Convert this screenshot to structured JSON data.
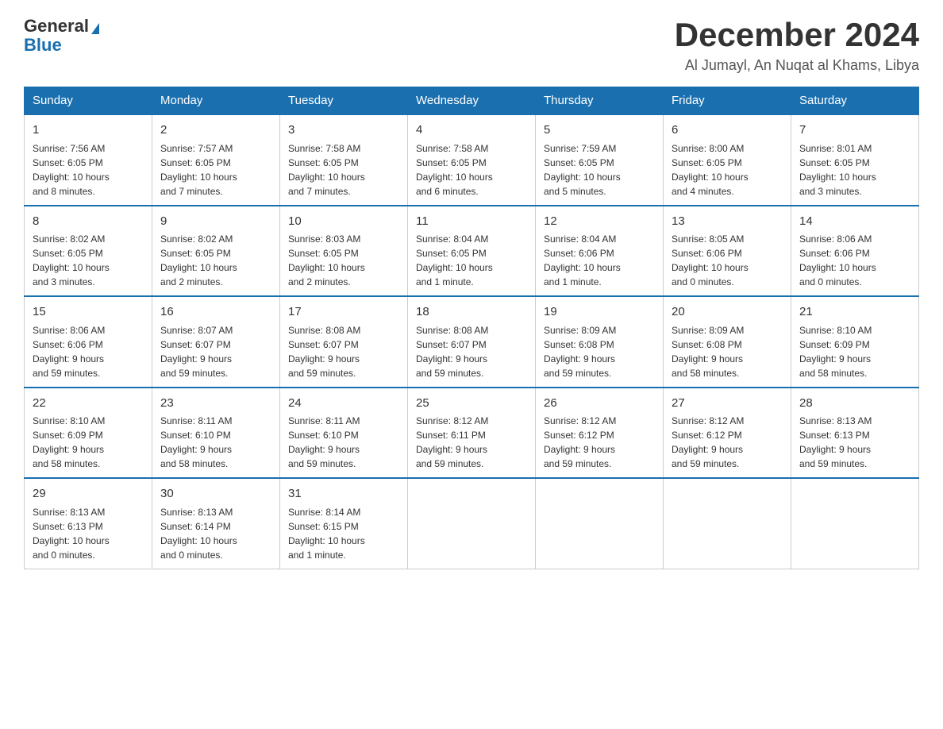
{
  "logo": {
    "general": "General",
    "triangle": "",
    "blue": "Blue"
  },
  "title": {
    "month": "December 2024",
    "location": "Al Jumayl, An Nuqat al Khams, Libya"
  },
  "headers": [
    "Sunday",
    "Monday",
    "Tuesday",
    "Wednesday",
    "Thursday",
    "Friday",
    "Saturday"
  ],
  "weeks": [
    [
      {
        "day": "1",
        "info": "Sunrise: 7:56 AM\nSunset: 6:05 PM\nDaylight: 10 hours\nand 8 minutes."
      },
      {
        "day": "2",
        "info": "Sunrise: 7:57 AM\nSunset: 6:05 PM\nDaylight: 10 hours\nand 7 minutes."
      },
      {
        "day": "3",
        "info": "Sunrise: 7:58 AM\nSunset: 6:05 PM\nDaylight: 10 hours\nand 7 minutes."
      },
      {
        "day": "4",
        "info": "Sunrise: 7:58 AM\nSunset: 6:05 PM\nDaylight: 10 hours\nand 6 minutes."
      },
      {
        "day": "5",
        "info": "Sunrise: 7:59 AM\nSunset: 6:05 PM\nDaylight: 10 hours\nand 5 minutes."
      },
      {
        "day": "6",
        "info": "Sunrise: 8:00 AM\nSunset: 6:05 PM\nDaylight: 10 hours\nand 4 minutes."
      },
      {
        "day": "7",
        "info": "Sunrise: 8:01 AM\nSunset: 6:05 PM\nDaylight: 10 hours\nand 3 minutes."
      }
    ],
    [
      {
        "day": "8",
        "info": "Sunrise: 8:02 AM\nSunset: 6:05 PM\nDaylight: 10 hours\nand 3 minutes."
      },
      {
        "day": "9",
        "info": "Sunrise: 8:02 AM\nSunset: 6:05 PM\nDaylight: 10 hours\nand 2 minutes."
      },
      {
        "day": "10",
        "info": "Sunrise: 8:03 AM\nSunset: 6:05 PM\nDaylight: 10 hours\nand 2 minutes."
      },
      {
        "day": "11",
        "info": "Sunrise: 8:04 AM\nSunset: 6:05 PM\nDaylight: 10 hours\nand 1 minute."
      },
      {
        "day": "12",
        "info": "Sunrise: 8:04 AM\nSunset: 6:06 PM\nDaylight: 10 hours\nand 1 minute."
      },
      {
        "day": "13",
        "info": "Sunrise: 8:05 AM\nSunset: 6:06 PM\nDaylight: 10 hours\nand 0 minutes."
      },
      {
        "day": "14",
        "info": "Sunrise: 8:06 AM\nSunset: 6:06 PM\nDaylight: 10 hours\nand 0 minutes."
      }
    ],
    [
      {
        "day": "15",
        "info": "Sunrise: 8:06 AM\nSunset: 6:06 PM\nDaylight: 9 hours\nand 59 minutes."
      },
      {
        "day": "16",
        "info": "Sunrise: 8:07 AM\nSunset: 6:07 PM\nDaylight: 9 hours\nand 59 minutes."
      },
      {
        "day": "17",
        "info": "Sunrise: 8:08 AM\nSunset: 6:07 PM\nDaylight: 9 hours\nand 59 minutes."
      },
      {
        "day": "18",
        "info": "Sunrise: 8:08 AM\nSunset: 6:07 PM\nDaylight: 9 hours\nand 59 minutes."
      },
      {
        "day": "19",
        "info": "Sunrise: 8:09 AM\nSunset: 6:08 PM\nDaylight: 9 hours\nand 59 minutes."
      },
      {
        "day": "20",
        "info": "Sunrise: 8:09 AM\nSunset: 6:08 PM\nDaylight: 9 hours\nand 58 minutes."
      },
      {
        "day": "21",
        "info": "Sunrise: 8:10 AM\nSunset: 6:09 PM\nDaylight: 9 hours\nand 58 minutes."
      }
    ],
    [
      {
        "day": "22",
        "info": "Sunrise: 8:10 AM\nSunset: 6:09 PM\nDaylight: 9 hours\nand 58 minutes."
      },
      {
        "day": "23",
        "info": "Sunrise: 8:11 AM\nSunset: 6:10 PM\nDaylight: 9 hours\nand 58 minutes."
      },
      {
        "day": "24",
        "info": "Sunrise: 8:11 AM\nSunset: 6:10 PM\nDaylight: 9 hours\nand 59 minutes."
      },
      {
        "day": "25",
        "info": "Sunrise: 8:12 AM\nSunset: 6:11 PM\nDaylight: 9 hours\nand 59 minutes."
      },
      {
        "day": "26",
        "info": "Sunrise: 8:12 AM\nSunset: 6:12 PM\nDaylight: 9 hours\nand 59 minutes."
      },
      {
        "day": "27",
        "info": "Sunrise: 8:12 AM\nSunset: 6:12 PM\nDaylight: 9 hours\nand 59 minutes."
      },
      {
        "day": "28",
        "info": "Sunrise: 8:13 AM\nSunset: 6:13 PM\nDaylight: 9 hours\nand 59 minutes."
      }
    ],
    [
      {
        "day": "29",
        "info": "Sunrise: 8:13 AM\nSunset: 6:13 PM\nDaylight: 10 hours\nand 0 minutes."
      },
      {
        "day": "30",
        "info": "Sunrise: 8:13 AM\nSunset: 6:14 PM\nDaylight: 10 hours\nand 0 minutes."
      },
      {
        "day": "31",
        "info": "Sunrise: 8:14 AM\nSunset: 6:15 PM\nDaylight: 10 hours\nand 1 minute."
      },
      null,
      null,
      null,
      null
    ]
  ]
}
